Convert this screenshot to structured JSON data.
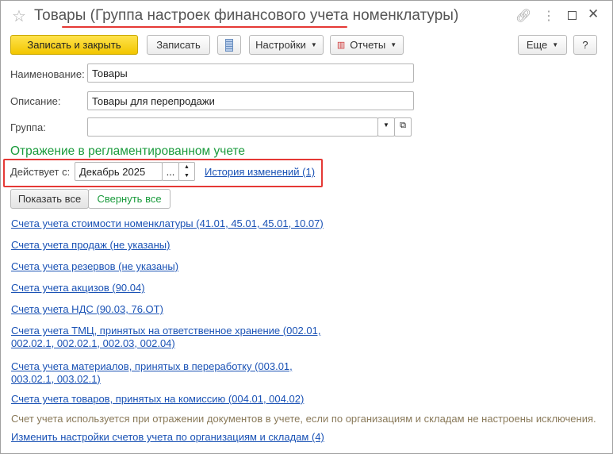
{
  "window": {
    "title": "Товары (Группа настроек финансового учета номенклатуры)"
  },
  "toolbar": {
    "save_close": "Записать и закрыть",
    "save": "Записать",
    "settings": "Настройки",
    "reports": "Отчеты",
    "more": "Еще",
    "help": "?"
  },
  "form": {
    "name_label": "Наименование:",
    "name_value": "Товары",
    "desc_label": "Описание:",
    "desc_value": "Товары для перепродажи",
    "group_label": "Группа:",
    "group_value": ""
  },
  "section": {
    "heading": "Отражение в регламентированном учете",
    "effective_label": "Действует с:",
    "effective_value": "Декабрь 2025",
    "history_link": "История изменений (1)",
    "show_all": "Показать все",
    "collapse_all": "Свернуть все"
  },
  "links": [
    "Счета учета стоимости номенклатуры (41.01, 45.01, 45.01, 10.07)",
    "Счета учета продаж (не указаны)",
    "Счета учета резервов (не указаны)",
    "Счета учета акцизов (90.04)",
    "Счета учета НДС (90.03, 76.ОТ)",
    "Счета учета ТМЦ, принятых на ответственное хранение (002.01,",
    "002.02.1, 002.02.1, 002.03, 002.04)",
    "Счета учета материалов, принятых в переработку (003.01,",
    "003.02.1, 003.02.1)",
    "Счета учета товаров, принятых на комиссию (004.01, 004.02)"
  ],
  "note": "Счет учета используется при отражении документов в учете, если  по организациям и складам не настроены исключения.",
  "bottom_link": "Изменить настройки счетов учета по организациям и складам (4)",
  "colors": {
    "accent_yellow": "#f2c600",
    "link": "#1a52b5",
    "heading_green": "#1a9b3c",
    "highlight_red": "#e53935",
    "note": "#8a7a5a"
  }
}
